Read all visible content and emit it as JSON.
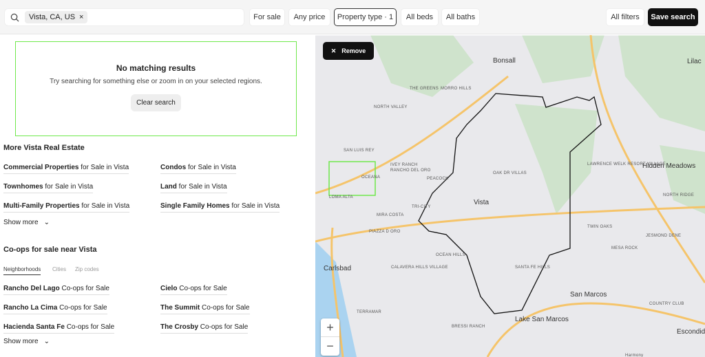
{
  "search": {
    "chip": "Vista, CA, US",
    "chip_close": "×"
  },
  "filters": {
    "for_sale": "For sale",
    "price": "Any price",
    "property_type": "Property type · 1",
    "beds": "All beds",
    "baths": "All baths",
    "all_filters": "All filters",
    "save_search": "Save search"
  },
  "no_results": {
    "title": "No matching results",
    "message": "Try searching for something else or zoom in on your selected regions.",
    "clear": "Clear search"
  },
  "more_real_estate": {
    "title": "More Vista Real Estate",
    "links": [
      {
        "bold": "Commercial Properties",
        "rest": " for Sale in Vista"
      },
      {
        "bold": "Condos",
        "rest": " for Sale in Vista"
      },
      {
        "bold": "Townhomes",
        "rest": " for Sale in Vista"
      },
      {
        "bold": "Land",
        "rest": " for Sale in Vista"
      },
      {
        "bold": "Multi-Family Properties",
        "rest": " for Sale in Vista"
      },
      {
        "bold": "Single Family Homes",
        "rest": " for Sale in Vista"
      }
    ],
    "show_more": "Show more"
  },
  "coops": {
    "title": "Co-ops for sale near Vista",
    "tabs": [
      "Neighborhoods",
      "Cities",
      "Zip codes"
    ],
    "links": [
      {
        "bold": "Rancho Del Lago",
        "rest": " Co-ops for Sale"
      },
      {
        "bold": "Cielo",
        "rest": " Co-ops for Sale"
      },
      {
        "bold": "Rancho La Cima",
        "rest": " Co-ops for Sale"
      },
      {
        "bold": "The Summit",
        "rest": " Co-ops for Sale"
      },
      {
        "bold": "Hacienda Santa Fe",
        "rest": " Co-ops for Sale"
      },
      {
        "bold": "The Crosby",
        "rest": " Co-ops for Sale"
      }
    ],
    "show_more": "Show more"
  },
  "map": {
    "remove": "Remove",
    "zoom_in": "+",
    "zoom_out": "−",
    "labels": [
      "Bonsall",
      "THE GREENS",
      "MORRO HILLS",
      "NORTH VALLEY",
      "SAN LUIS REY",
      "IVEY RANCH",
      "RANCHO DEL ORO",
      "OCEANA",
      "PEACOCK",
      "OAK DR VILLAS",
      "LAWRENCE WELK RESORT VILLAGE",
      "Hidden Meadows",
      "Lilac",
      "NORTH RIDGE",
      "Vista",
      "TRI-CITY",
      "MIRA COSTA",
      "LOMA ALTA",
      "PIAZZA D ORO",
      "TWIN OAKS",
      "JESMOND DENE",
      "MESA ROCK",
      "OCEAN HILLS",
      "Carlsbad",
      "CALAVERA HILLS VILLAGE",
      "SANTA FE HILLS",
      "COUNTRY CLUB",
      "San Marcos",
      "Lake San Marcos",
      "TERRAMAR",
      "BRESSI RANCH",
      "Escondido",
      "Harmony"
    ]
  },
  "colors": {
    "accent_green": "#6ee84a",
    "dark": "#111111"
  }
}
